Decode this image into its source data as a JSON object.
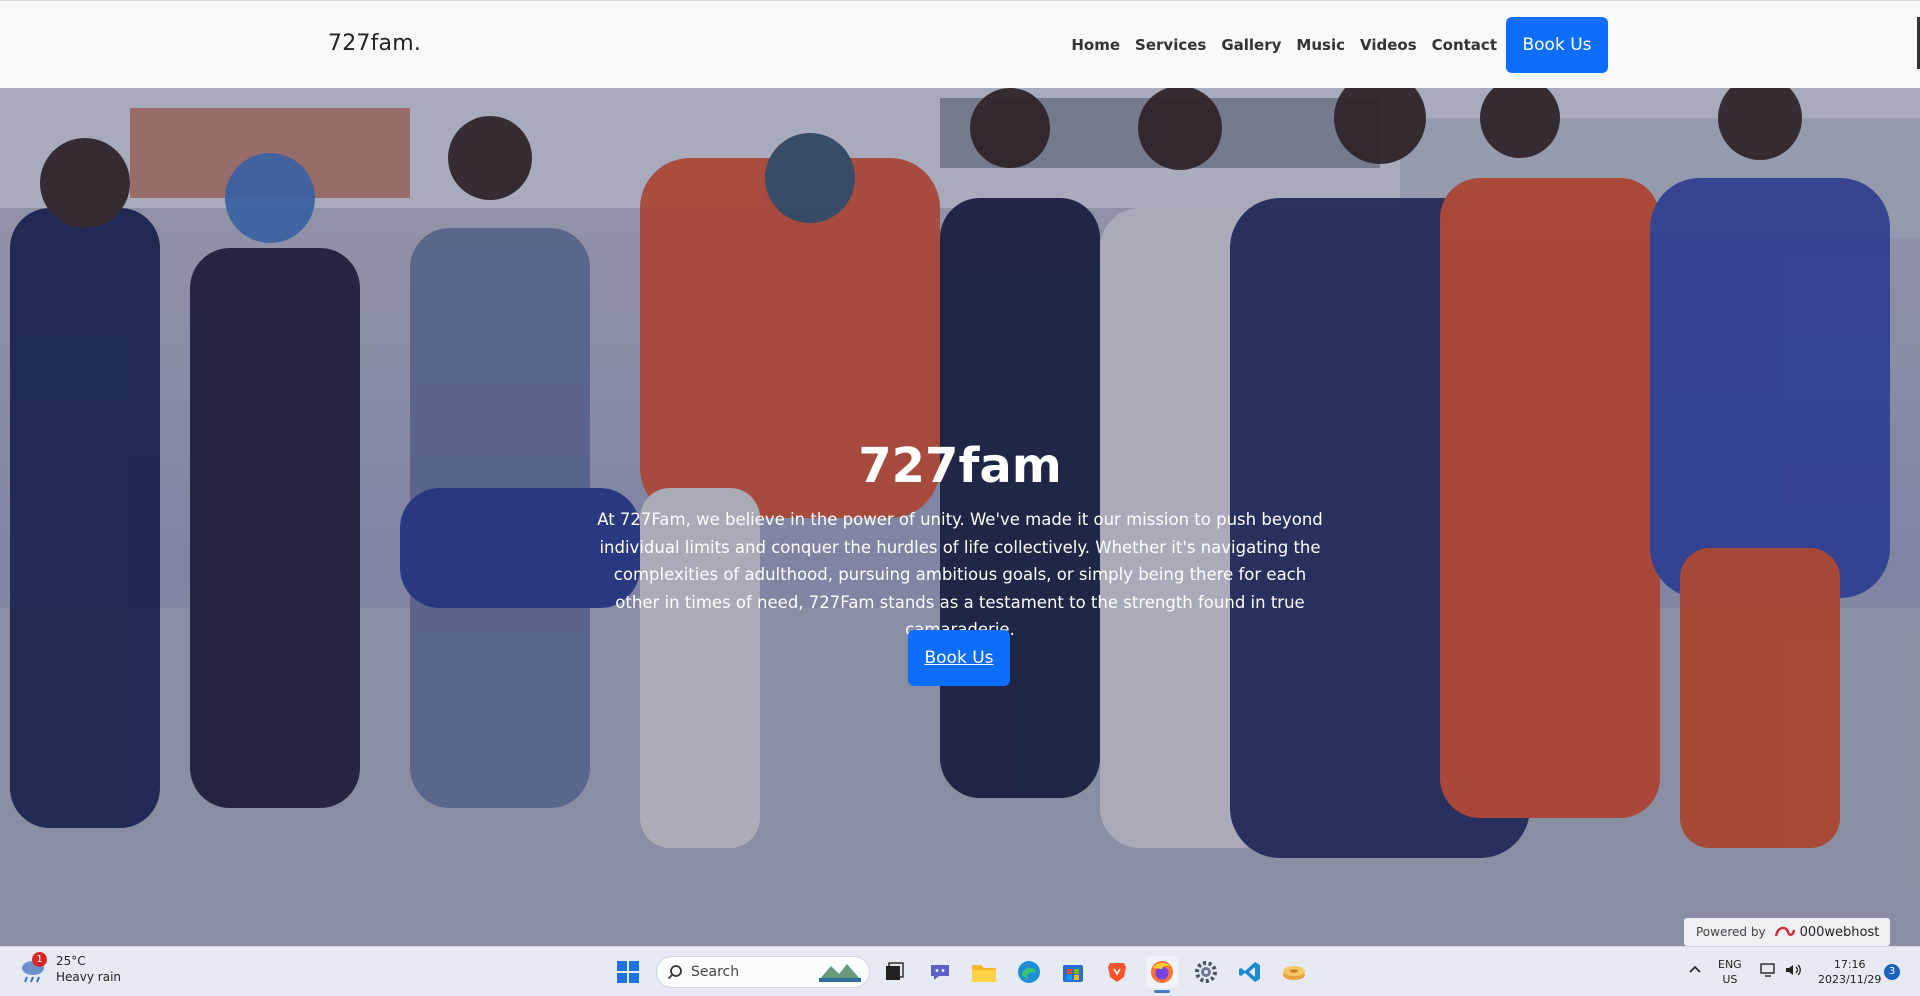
{
  "navbar": {
    "brand": "727fam.",
    "links": [
      {
        "label": "Home"
      },
      {
        "label": "Services"
      },
      {
        "label": "Gallery"
      },
      {
        "label": "Music"
      },
      {
        "label": "Videos"
      },
      {
        "label": "Contact"
      }
    ],
    "cta_label": "Book Us"
  },
  "hero": {
    "title": "727fam",
    "text": "At 727Fam, we believe in the power of unity. We've made it our mission to push beyond individual limits and conquer the hurdles of life collectively. Whether it's navigating the complexities of adulthood, pursuing ambitious goals, or simply being there for each other in times of need, 727Fam stands as a testament to the strength found in true camaraderie.",
    "button_label": "Book Us",
    "overlay_color": "#1b2250"
  },
  "powered_badge": {
    "label": "Powered by",
    "brand": "000webhost"
  },
  "taskbar": {
    "weather": {
      "temp": "25°C",
      "condition": "Heavy rain",
      "badge": "1"
    },
    "search_placeholder": "Search",
    "apps": [
      "windows-start-icon",
      "task-view-icon",
      "teams-chat-icon",
      "file-explorer-icon",
      "edge-icon",
      "store-icon",
      "brave-icon",
      "firefox-icon",
      "settings-icon",
      "vscode-icon",
      "disk-icon"
    ],
    "language": {
      "lang": "ENG",
      "region": "US"
    },
    "clock": {
      "time": "17:16",
      "date": "2023/11/29"
    },
    "notifications": "3"
  },
  "colors": {
    "primary": "#0d6efd",
    "navbar_bg": "#f8f9fa",
    "taskbar_bg": "#e6ebf3"
  }
}
